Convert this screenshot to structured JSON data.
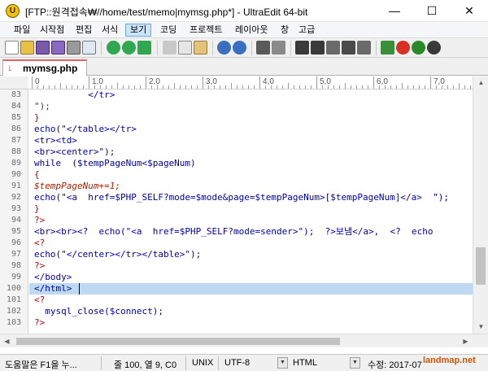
{
  "window": {
    "title": "[FTP::원격접속₩//home/test/memo|mymsg.php*] - UltraEdit 64-bit",
    "app_icon": "U",
    "min_glyph": "—",
    "max_glyph": "☐",
    "close_glyph": "✕"
  },
  "menu": [
    "파일",
    "시작점",
    "편집",
    "서식",
    "보기",
    "코딩",
    "프로젝트",
    "레이아웃",
    "창",
    "고급"
  ],
  "tab": {
    "label": "mymsg.php",
    "icon": "file-modified-icon"
  },
  "ruler": [
    "0",
    "1,0",
    "2,0",
    "3,0",
    "4,0",
    "5,0",
    "6,0",
    "7,0"
  ],
  "line_numbers": [
    "83",
    "84",
    "85",
    "86",
    "87",
    "88",
    "89",
    "90",
    "91",
    "92",
    "93",
    "94",
    "95",
    "96",
    "97",
    "98",
    "99",
    "100",
    "101",
    "102",
    "103"
  ],
  "code": [
    {
      "t": "tag",
      "v": "          </tr>"
    },
    {
      "t": "str",
      "v": "\");"
    },
    {
      "t": "php",
      "v": "}"
    },
    {
      "t": "kw",
      "v": "echo(\"</table></tr>"
    },
    {
      "t": "tag",
      "v": "<tr><td>"
    },
    {
      "t": "tag",
      "v": "<br><center>\");"
    },
    {
      "t": "kw",
      "v": "while  ($tempPageNum<$pageNum)"
    },
    {
      "t": "php",
      "v": "{"
    },
    {
      "t": "var",
      "v": "$tempPageNum+=1;"
    },
    {
      "t": "kw",
      "v": "echo(\"<a  href=$PHP_SELF?mode=$mode&page=$tempPageNum>[$tempPageNum]</a>  \");"
    },
    {
      "t": "php",
      "v": "}"
    },
    {
      "t": "php",
      "v": "?>"
    },
    {
      "t": "tag",
      "v": "<br><br><?  echo(\"<a  href=$PHP_SELF?mode=sender>\");  ?>보냄</a>,  <?  echo"
    },
    {
      "t": "php",
      "v": "<?"
    },
    {
      "t": "kw",
      "v": "echo(\"</center></tr></table>\");"
    },
    {
      "t": "php",
      "v": "?>"
    },
    {
      "t": "tag",
      "v": "</body>"
    },
    {
      "t": "tag",
      "v": "</html>"
    },
    {
      "t": "php",
      "v": "<?"
    },
    {
      "t": "kw",
      "v": "  mysql_close($connect);"
    },
    {
      "t": "php",
      "v": "?>"
    }
  ],
  "status": {
    "help": "도움말은 F1을 누...",
    "position": "줄 100, 열 9, C0",
    "line_ending": "UNIX",
    "encoding": "UTF-8",
    "syntax": "HTML",
    "modified": "수정: 2017-07",
    "watermark": "landmap.net"
  },
  "colors": {
    "accent": "#6fa8dc",
    "selection": "#bfd9f2",
    "tag": "#0000a8",
    "php_delim": "#c00000"
  }
}
